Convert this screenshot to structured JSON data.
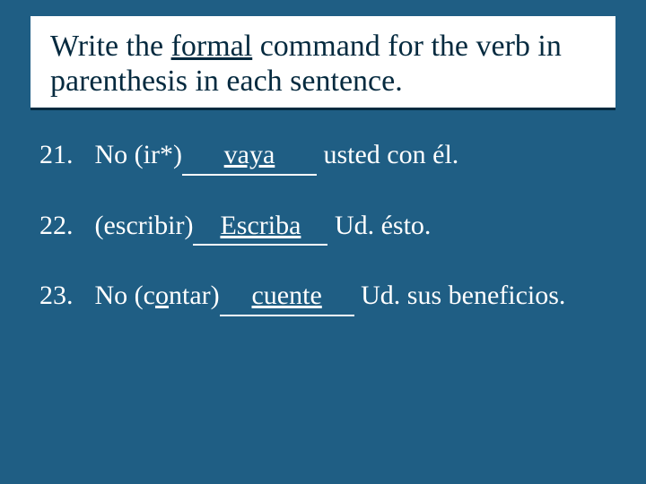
{
  "title": {
    "pre": "Write the ",
    "underlined": "formal",
    "post": " command for the verb in parenthesis in each sentence."
  },
  "items": [
    {
      "num": "21.",
      "pre": "No (ir*)",
      "answer": "vaya",
      "post": " usted con él."
    },
    {
      "num": "22.",
      "pre": "(escribir)",
      "answer": "Escriba",
      "post": " Ud. ésto."
    },
    {
      "num": "23.",
      "pre_a": "No (c",
      "pre_u": "o",
      "pre_b": "ntar)",
      "answer": "cuente",
      "post": " Ud. sus beneficios."
    }
  ]
}
